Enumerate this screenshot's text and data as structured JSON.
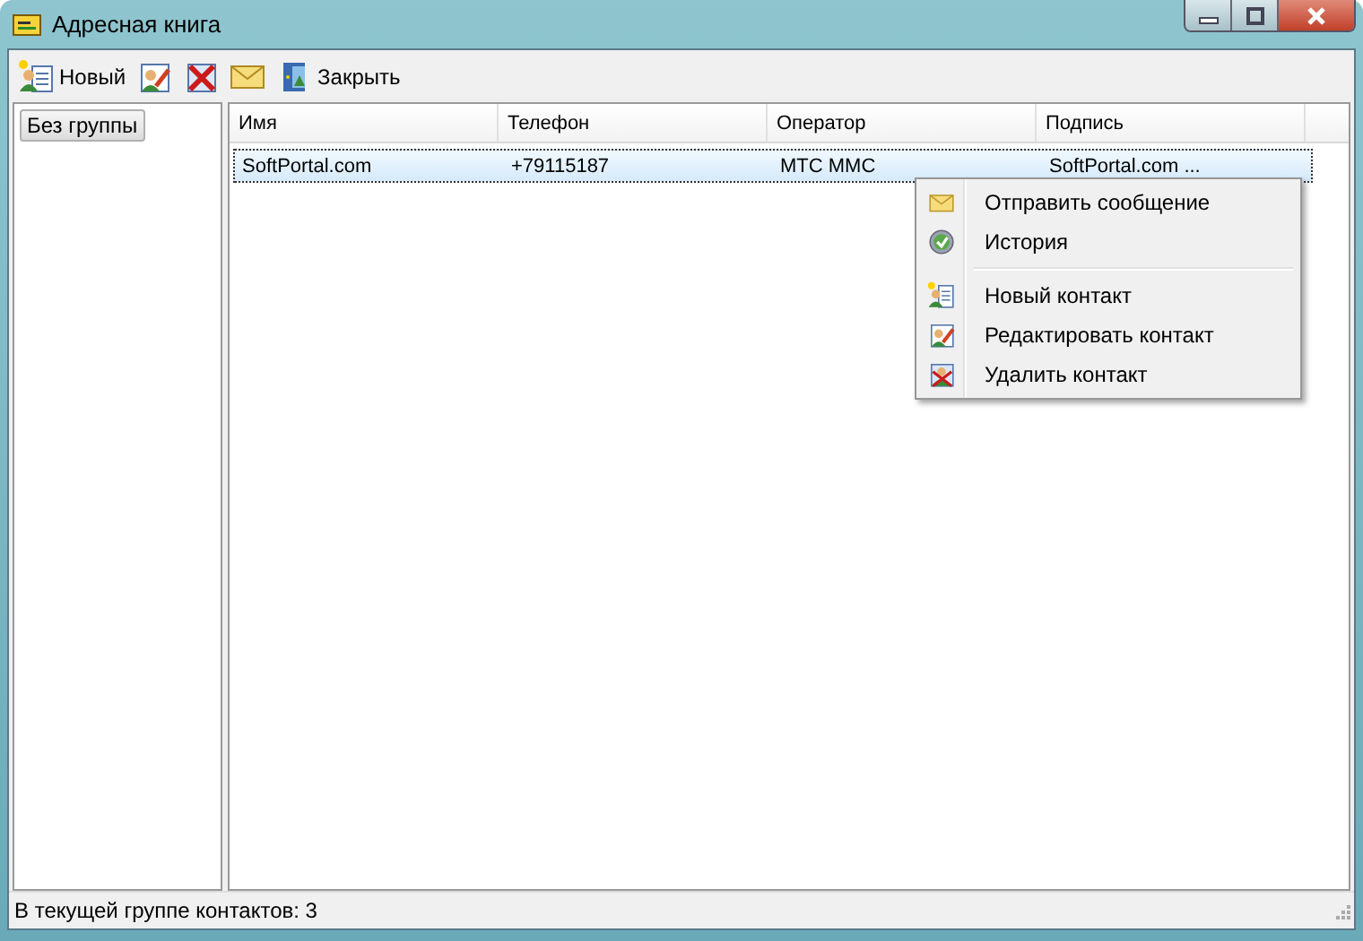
{
  "window": {
    "title": "Адресная книга"
  },
  "toolbar": [
    {
      "kind": "new",
      "label": "Новый"
    },
    {
      "kind": "edit"
    },
    {
      "kind": "delete"
    },
    {
      "kind": "message"
    },
    {
      "kind": "exit",
      "label": "Закрыть"
    }
  ],
  "groups": [
    {
      "label": "Без группы",
      "selected": true
    }
  ],
  "table": {
    "columns": [
      "Имя",
      "Телефон",
      "Оператор",
      "Подпись"
    ],
    "rows": [
      {
        "cells": [
          "SoftPortal.com",
          "+79115187",
          "МТС MMC",
          "SoftPortal.com ..."
        ],
        "selected": true
      }
    ]
  },
  "context_menu": [
    {
      "kind": "message",
      "label": "Отправить сообщение"
    },
    {
      "kind": "history",
      "label": "История"
    },
    {
      "kind": "separator"
    },
    {
      "kind": "new",
      "label": "Новый контакт"
    },
    {
      "kind": "edit",
      "label": "Редактировать контакт"
    },
    {
      "kind": "delete",
      "label": "Удалить контакт"
    }
  ],
  "status_bar": "В текущей группе контактов: 3"
}
